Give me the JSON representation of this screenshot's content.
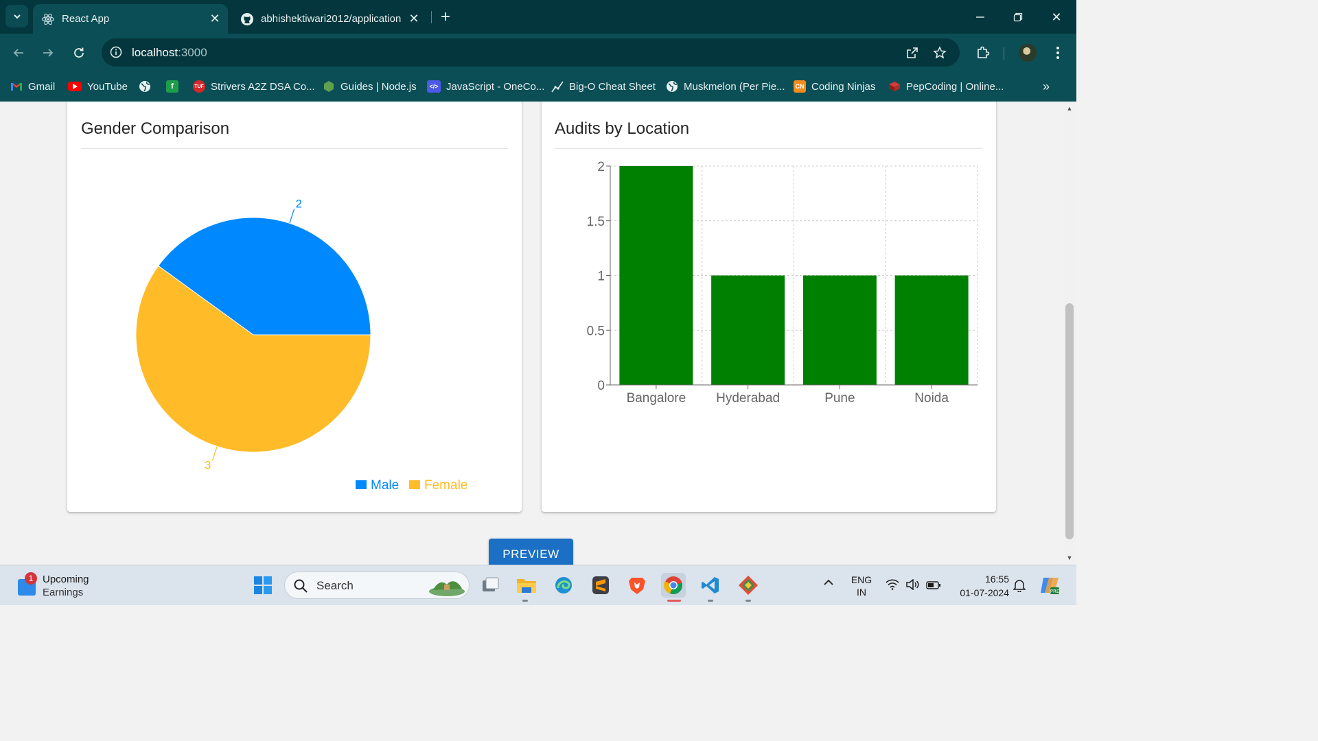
{
  "browser": {
    "tabs": [
      {
        "title": "React App",
        "active": true,
        "icon": "react-icon"
      },
      {
        "title": "abhishektiwari2012/application",
        "active": false,
        "icon": "github-icon"
      }
    ],
    "url_host": "localhost",
    "url_port": ":3000",
    "bookmarks": [
      {
        "label": "Gmail",
        "icon": "gmail-icon"
      },
      {
        "label": "YouTube",
        "icon": "youtube-icon"
      },
      {
        "label": "",
        "icon": "globe-icon"
      },
      {
        "label": "",
        "icon": "green-bookmark-icon"
      },
      {
        "label": "Strivers A2Z DSA Co...",
        "icon": "tuf-icon"
      },
      {
        "label": "Guides | Node.js",
        "icon": "nodejs-icon"
      },
      {
        "label": "JavaScript - OneCo...",
        "icon": "code-icon"
      },
      {
        "label": "Big-O Cheat Sheet",
        "icon": "chart-line-icon"
      },
      {
        "label": "Muskmelon (Per Pie...",
        "icon": "globe-icon"
      },
      {
        "label": "Coding Ninjas",
        "icon": "coding-ninjas-icon"
      },
      {
        "label": "PepCoding | Online...",
        "icon": "pepcoding-icon"
      }
    ]
  },
  "page": {
    "preview_label": "PREVIEW"
  },
  "charts": {
    "gender": {
      "title": "Gender Comparison"
    },
    "location": {
      "title": "Audits by Location"
    }
  },
  "chart_data": [
    {
      "type": "pie",
      "title": "Gender Comparison",
      "categories": [
        "Male",
        "Female"
      ],
      "values": [
        2,
        3
      ],
      "colors": [
        "#0088fe",
        "#ffbb28"
      ],
      "legend": "bottom-right"
    },
    {
      "type": "bar",
      "title": "Audits by Location",
      "categories": [
        "Bangalore",
        "Hyderabad",
        "Pune",
        "Noida"
      ],
      "values": [
        2,
        1,
        1,
        1
      ],
      "yticks": [
        "0",
        "0.5",
        "1",
        "1.5",
        "2"
      ],
      "ylim": [
        0,
        2
      ],
      "color": "#008000",
      "grid": true
    }
  ],
  "taskbar": {
    "widget_line1": "Upcoming",
    "widget_line2": "Earnings",
    "widget_badge": "1",
    "search_label": "Search",
    "lang_line1": "ENG",
    "lang_line2": "IN",
    "time": "16:55",
    "date": "01-07-2024"
  }
}
